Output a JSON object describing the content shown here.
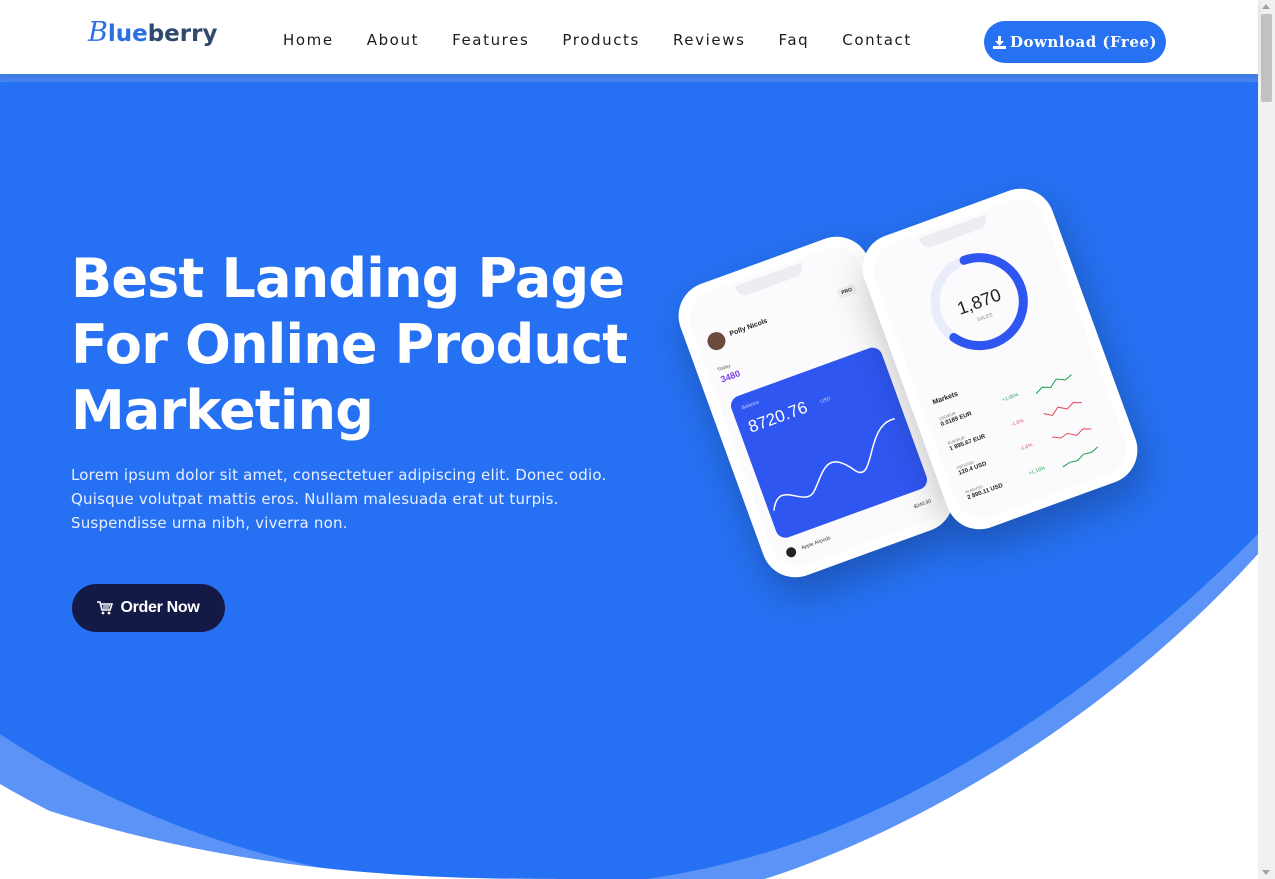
{
  "logo": {
    "b": "B",
    "lue": "lue",
    "rest": "berry"
  },
  "nav": [
    "Home",
    "About",
    "Features",
    "Products",
    "Reviews",
    "Faq",
    "Contact"
  ],
  "download_label": "Download (Free)",
  "hero": {
    "title_lines": [
      "Best Landing Page",
      "For Online Product",
      "Marketing"
    ],
    "description_lines": [
      "Lorem ipsum dolor sit amet, consectetuer adipiscing elit. Donec odio.",
      "Quisque volutpat mattis eros. Nullam malesuada erat ut turpis.",
      "Suspendisse urna nibh, viverra non."
    ],
    "order_label": "Order Now"
  },
  "phone_left": {
    "name": "Polly Nicols",
    "badge": "PRO",
    "today_label": "Today",
    "today_value": "3480",
    "balance_label": "Balance",
    "balance_value": "8720.76",
    "currency": "USD",
    "item_name": "Apple Airpods",
    "item_price": "$240.90"
  },
  "phone_right": {
    "sales_value": "1,870",
    "sales_label": "SALES",
    "markets_label": "Markets",
    "markets": [
      {
        "pair": "USD/EUR",
        "value": "0.0189 EUR",
        "change": "+1.05%"
      },
      {
        "pair": "RUB/EUR",
        "value": "1 895.67 EUR",
        "change": "-1.6%"
      },
      {
        "pair": "USD/USD",
        "value": "120.4 USD",
        "change": "-1.6%"
      },
      {
        "pair": "RUB/USD",
        "value": "2 890.11 USD",
        "change": "+1.15%"
      }
    ]
  },
  "colors": {
    "primary": "#2671f3",
    "dark_button": "#141a46",
    "logo_dark": "#2f4a6d"
  }
}
